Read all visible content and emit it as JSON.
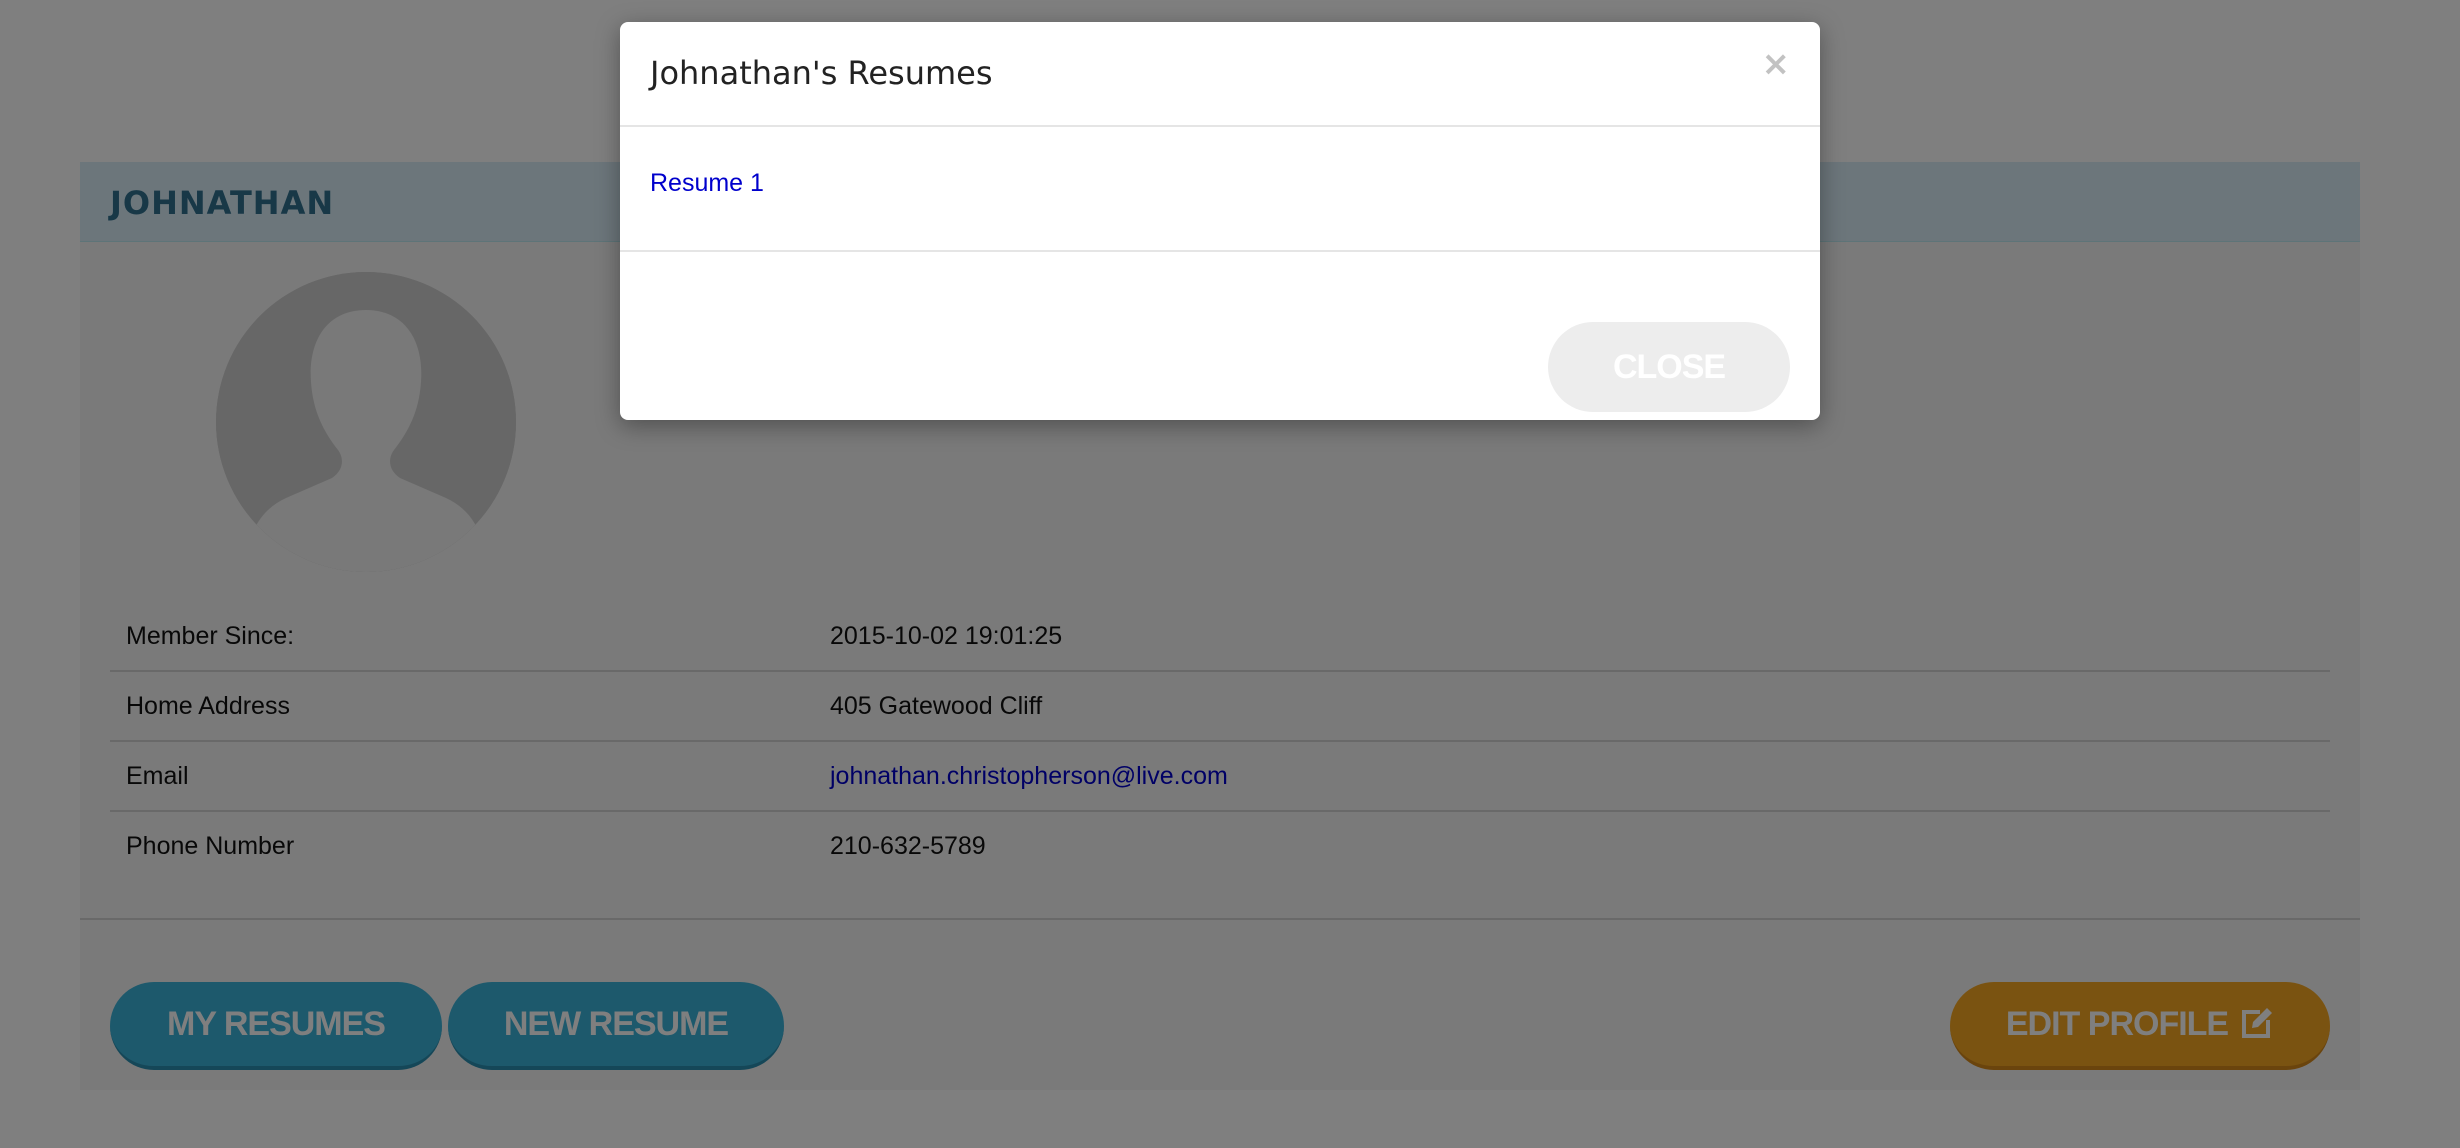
{
  "profile": {
    "name": "JOHNATHAN",
    "fields": [
      {
        "label": "Member Since:",
        "value": "2015-10-02 19:01:25"
      },
      {
        "label": "Home Address",
        "value": "405 Gatewood Cliff"
      },
      {
        "label": "Email",
        "value": "johnathan.christopherson@live.com"
      },
      {
        "label": "Phone Number",
        "value": "210-632-5789"
      }
    ],
    "buttons": {
      "my_resumes": "MY RESUMES",
      "new_resume": "NEW RESUME",
      "edit_profile": "EDIT PROFILE"
    }
  },
  "modal": {
    "title": "Johnathan's Resumes",
    "close_x": "×",
    "resumes": [
      "Resume 1"
    ],
    "close_button": "CLOSE"
  },
  "colors": {
    "header_bg": "#d9edf7",
    "header_text": "#31708f",
    "primary_button": "#3bb2d9",
    "edit_button": "#f5a623",
    "link": "#0000cc",
    "backdrop": "rgba(0,0,0,0.5)"
  },
  "icons": {
    "avatar": "user-silhouette-icon",
    "edit": "edit-square-icon",
    "close": "close-icon"
  }
}
